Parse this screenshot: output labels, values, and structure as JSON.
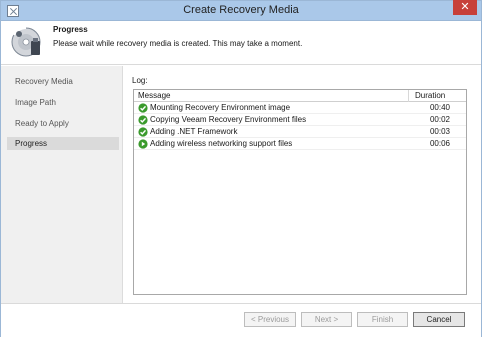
{
  "window": {
    "title": "Create Recovery Media",
    "close_glyph": "✕"
  },
  "header": {
    "title": "Progress",
    "description": "Please wait while recovery media is created. This may take a moment.",
    "icon": "recovery-media-icon"
  },
  "sidebar": {
    "items": [
      {
        "label": "Recovery Media"
      },
      {
        "label": "Image Path"
      },
      {
        "label": "Ready to Apply"
      },
      {
        "label": "Progress"
      }
    ]
  },
  "log": {
    "label": "Log:",
    "columns": {
      "message": "Message",
      "duration": "Duration"
    },
    "rows": [
      {
        "message": "Mounting Recovery Environment image",
        "duration": "00:40",
        "status": "success"
      },
      {
        "message": "Copying Veeam Recovery Environment files",
        "duration": "00:02",
        "status": "success"
      },
      {
        "message": "Adding .NET Framework",
        "duration": "00:03",
        "status": "success"
      },
      {
        "message": "Adding wireless networking support files",
        "duration": "00:06",
        "status": "in-progress"
      }
    ]
  },
  "buttons": {
    "previous": "< Previous",
    "next": "Next >",
    "finish": "Finish",
    "cancel": "Cancel"
  },
  "colors": {
    "titlebar": "#aac8e9",
    "success": "#3a9a2c",
    "close": "#c7403a"
  }
}
